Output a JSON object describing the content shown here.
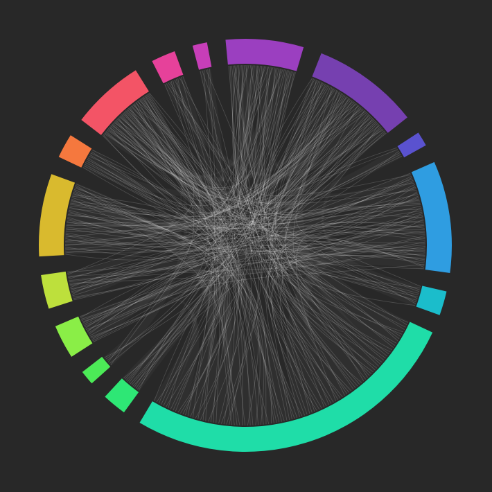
{
  "colors": {
    "background": "#282828",
    "link": "#ffffff"
  },
  "groups": [
    {
      "id": "g-purple",
      "color": "#9B3FC0",
      "size": 16
    },
    {
      "id": "g-violet",
      "color": "#7640B0",
      "size": 22
    },
    {
      "id": "g-indigo",
      "color": "#5A52CF",
      "size": 3
    },
    {
      "id": "g-blue",
      "color": "#2F9DE1",
      "size": 23
    },
    {
      "id": "g-teal",
      "color": "#1BBDCB",
      "size": 5
    },
    {
      "id": "g-green-teal",
      "color": "#1FDDA8",
      "size": 70
    },
    {
      "id": "g-green",
      "color": "#2EE775",
      "size": 5
    },
    {
      "id": "g-lime-green",
      "color": "#4CEB57",
      "size": 3
    },
    {
      "id": "g-light-green",
      "color": "#8AEE47",
      "size": 7
    },
    {
      "id": "g-yellow-green",
      "color": "#BDE03C",
      "size": 7
    },
    {
      "id": "g-mustard",
      "color": "#D9BA2E",
      "size": 17
    },
    {
      "id": "g-orange",
      "color": "#F5783E",
      "size": 5
    },
    {
      "id": "g-coral",
      "color": "#F35466",
      "size": 15
    },
    {
      "id": "g-pink",
      "color": "#E6419A",
      "size": 5
    },
    {
      "id": "g-magenta",
      "color": "#C73EB8",
      "size": 3
    }
  ],
  "links": [
    [
      "g-purple",
      "g-green-teal",
      5
    ],
    [
      "g-purple",
      "g-mustard",
      3
    ],
    [
      "g-purple",
      "g-blue",
      2
    ],
    [
      "g-purple",
      "g-coral",
      2
    ],
    [
      "g-purple",
      "g-yellow-green",
      2
    ],
    [
      "g-purple",
      "g-light-green",
      2
    ],
    [
      "g-violet",
      "g-green-teal",
      8
    ],
    [
      "g-violet",
      "g-coral",
      3
    ],
    [
      "g-violet",
      "g-mustard",
      3
    ],
    [
      "g-violet",
      "g-orange",
      2
    ],
    [
      "g-violet",
      "g-green",
      2
    ],
    [
      "g-violet",
      "g-pink",
      2
    ],
    [
      "g-violet",
      "g-teal",
      2
    ],
    [
      "g-indigo",
      "g-mustard",
      2
    ],
    [
      "g-blue",
      "g-coral",
      4
    ],
    [
      "g-blue",
      "g-mustard",
      4
    ],
    [
      "g-blue",
      "g-green-teal",
      6
    ],
    [
      "g-blue",
      "g-yellow-green",
      3
    ],
    [
      "g-blue",
      "g-light-green",
      3
    ],
    [
      "g-teal",
      "g-coral",
      2
    ],
    [
      "g-green-teal",
      "g-coral",
      4
    ],
    [
      "g-green-teal",
      "g-mustard",
      5
    ],
    [
      "g-green-teal",
      "g-pink",
      2
    ],
    [
      "g-green-teal",
      "g-orange",
      2
    ],
    [
      "g-green-teal",
      "g-magenta",
      2
    ],
    [
      "g-green-teal",
      "g-light-green",
      2
    ],
    [
      "g-green-teal",
      "g-green",
      2
    ],
    [
      "g-lime-green",
      "g-coral",
      2
    ],
    [
      "g-yellow-green",
      "g-coral",
      2
    ]
  ]
}
